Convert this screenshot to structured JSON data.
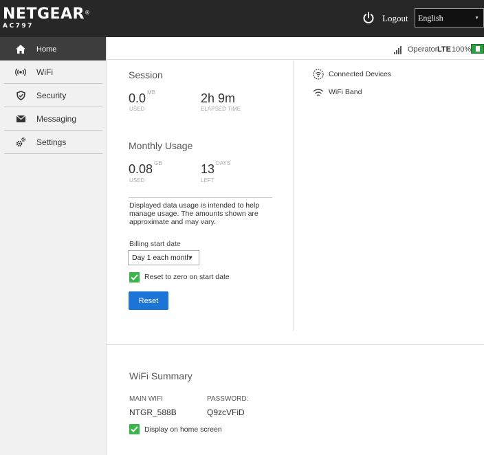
{
  "header": {
    "brand": "NETGEAR",
    "brand_mark": "®",
    "model": "AC797",
    "logout_label": "Logout",
    "language": "English"
  },
  "sidebar": {
    "items": [
      {
        "label": "Home",
        "icon": "home-icon",
        "active": true
      },
      {
        "label": "WiFi",
        "icon": "wifi-broadcast-icon",
        "active": false
      },
      {
        "label": "Security",
        "icon": "shield-icon",
        "active": false
      },
      {
        "label": "Messaging",
        "icon": "envelope-icon",
        "active": false
      },
      {
        "label": "Settings",
        "icon": "gears-icon",
        "active": false
      }
    ]
  },
  "status": {
    "operator": "Operator",
    "network": "LTE",
    "battery": "100%"
  },
  "session": {
    "title": "Session",
    "used_value": "0.0",
    "used_unit": "MB",
    "used_label": "USED",
    "elapsed_value": "2h 9m",
    "elapsed_label": "ELAPSED TIME"
  },
  "monthly": {
    "title": "Monthly Usage",
    "used_value": "0.08",
    "used_unit": "GB",
    "used_label": "USED",
    "days_value": "13",
    "days_unit": "DAYS",
    "days_label": "LEFT",
    "disclaimer": "Displayed data usage is intended to help manage usage. The amounts shown are approximate and may vary.",
    "billing_label": "Billing start date",
    "billing_value": "Day 1 each month",
    "reset_checkbox_label": "Reset to zero on start date",
    "reset_checked": true,
    "reset_button": "Reset"
  },
  "right_panel": {
    "connected_devices": "Connected Devices",
    "wifi_band": "WiFi Band"
  },
  "wifi_summary": {
    "title": "WiFi Summary",
    "main_wifi_label": "MAIN WIFI",
    "main_wifi_value": "NTGR_588B",
    "password_label": "PASSWORD:",
    "password_value": "Q9zcVFiD",
    "display_label": "Display on home screen",
    "display_checked": true
  },
  "colors": {
    "header_bg": "#272727",
    "sidebar_bg": "#f1f1f1",
    "active_nav": "#3d3d3d",
    "checkbox_green": "#39b54a",
    "button_blue": "#1c74d6",
    "battery_green": "#2f9e44"
  }
}
